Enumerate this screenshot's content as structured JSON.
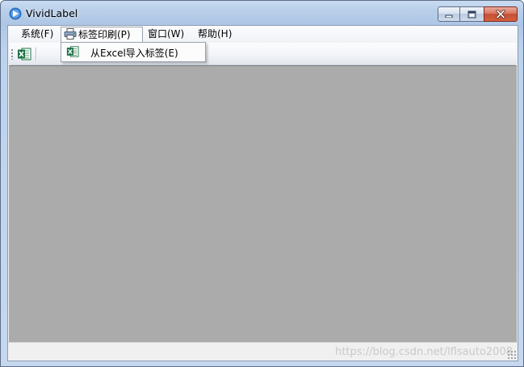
{
  "window": {
    "title": "VividLabel",
    "app_icon": "vividlabel-logo-icon",
    "controls": [
      "minimize-icon",
      "maximize-icon",
      "close-icon"
    ]
  },
  "menubar": {
    "items": [
      {
        "label": "系统(F)"
      },
      {
        "label": "标签印刷(P)",
        "icon": "printer-icon",
        "open": true
      },
      {
        "label": "窗口(W)"
      },
      {
        "label": "帮助(H)"
      }
    ]
  },
  "toolbar": {
    "buttons": [
      {
        "icon": "excel-icon"
      }
    ]
  },
  "dropdown": {
    "items": [
      {
        "label": "从Excel导入标签(E)",
        "icon": "excel-icon"
      }
    ]
  },
  "statusbar": {
    "watermark": "https://blog.csdn.net/lflsauto2008"
  },
  "colors": {
    "mdi_background": "#ababab",
    "excel_green": "#1e7145",
    "close_button": "#c44f35"
  }
}
